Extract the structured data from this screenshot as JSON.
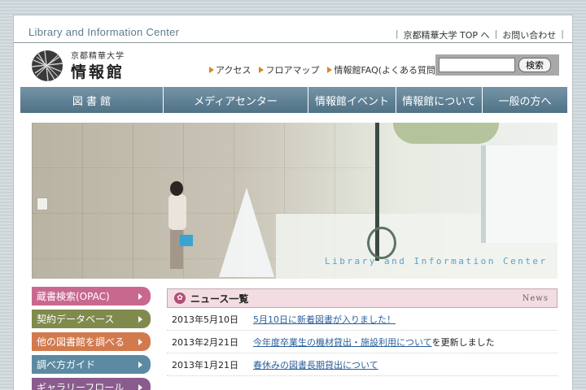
{
  "topbar": {
    "site_title": "Library and Information Center",
    "links": [
      "京都精華大学 TOP へ",
      "お問い合わせ"
    ]
  },
  "header": {
    "logo_small": "京都精華大学",
    "logo_big": "情報館",
    "quicklinks": [
      "アクセス",
      "フロアマップ",
      "情報館FAQ(よくある質問)"
    ],
    "search": {
      "placeholder": "",
      "button_label": "検索"
    }
  },
  "nav": {
    "items": [
      {
        "label": "図 書 館"
      },
      {
        "label": "メディアセンター"
      },
      {
        "label": "情報館イベント"
      },
      {
        "label": "情報館について"
      },
      {
        "label": "一般の方へ"
      }
    ]
  },
  "hero": {
    "caption": "Library and Information Center"
  },
  "sidebar": {
    "items": [
      {
        "label": "蔵書検索(OPAC)",
        "color": "#c9688e"
      },
      {
        "label": "契約データベース",
        "color": "#7f8a4c"
      },
      {
        "label": "他の図書館を調べる",
        "color": "#d27a4e"
      },
      {
        "label": "調べ方ガイド",
        "color": "#5c8aa2"
      },
      {
        "label": "ギャラリーフロール",
        "color": "#8a5c8e"
      }
    ]
  },
  "news": {
    "title": "ニュース一覧",
    "en_label": "News",
    "items": [
      {
        "date": "2013年5月10日",
        "link": "5月10日に新着図書が入りました！",
        "suffix": ""
      },
      {
        "date": "2013年2月21日",
        "link": "今年度卒業生の機材貸出・施設利用について",
        "suffix": "を更新しました"
      },
      {
        "date": "2013年1月21日",
        "link": "春休みの図書長期貸出について",
        "suffix": ""
      }
    ]
  },
  "colors": {
    "nav": "#5e8196",
    "news_accent": "#b24d74",
    "quicklink_arrow": "#d68b1a"
  }
}
